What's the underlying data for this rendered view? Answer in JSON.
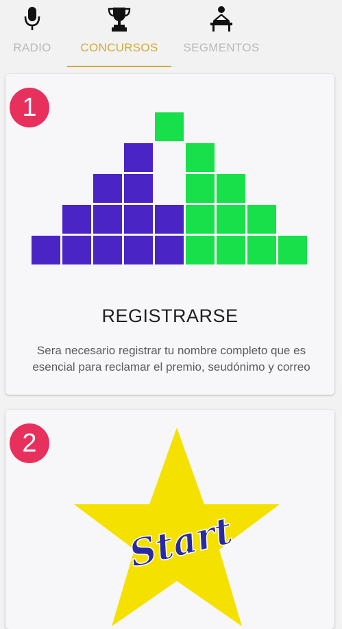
{
  "tabs": [
    {
      "label": "RADIO",
      "icon": "microphone-icon",
      "active": false
    },
    {
      "label": "CONCURSOS",
      "icon": "trophy-icon",
      "active": true
    },
    {
      "label": "SEGMENTOS",
      "icon": "person-at-desk-icon",
      "active": false
    }
  ],
  "colors": {
    "accent": "#d2a93a",
    "inactive_tab": "#b9b9b9",
    "badge": "#e8305d",
    "purple_block": "#4a24c5",
    "green_block": "#17e04a",
    "star_yellow": "#f5e100",
    "start_text_blue": "#2a2aa0"
  },
  "cards": [
    {
      "number": "1",
      "image": "pyramid-blocks-illustration",
      "title": "REGISTRARSE",
      "description": "Sera necesario registrar tu nombre completo que es esencial para reclamar el premio, seudónimo y correo"
    },
    {
      "number": "2",
      "image": "star-start-illustration",
      "image_text": "Start"
    }
  ]
}
